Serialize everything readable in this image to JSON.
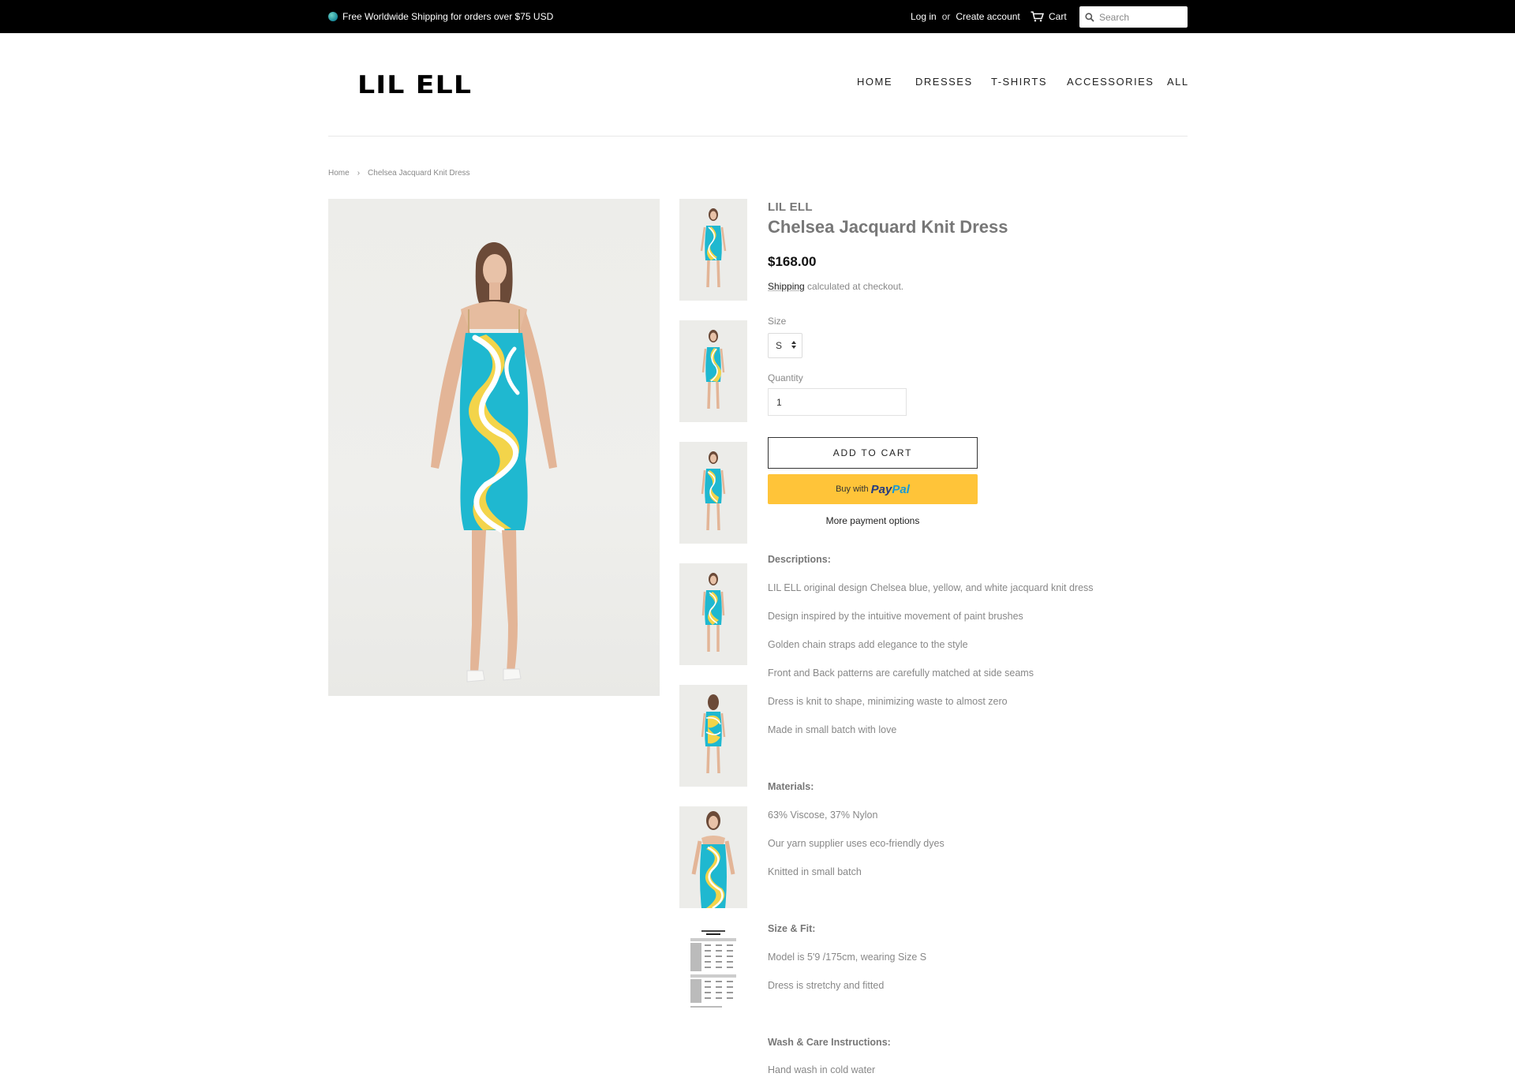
{
  "announcement": {
    "text": "Free Worldwide Shipping for orders over $75 USD",
    "icon": "globe-icon"
  },
  "account": {
    "login": "Log in",
    "or": "or",
    "create": "Create account"
  },
  "cart": {
    "label": "Cart",
    "icon": "cart-icon"
  },
  "search": {
    "placeholder": "Search",
    "icon": "search-icon"
  },
  "brand": {
    "logo": "LIL ELL"
  },
  "nav": {
    "items": [
      "HOME",
      "DRESSES",
      "T-SHIRTS",
      "ACCESSORIES",
      "ALL"
    ]
  },
  "breadcrumb": {
    "home": "Home",
    "separator": "›",
    "current": "Chelsea Jacquard Knit Dress"
  },
  "product": {
    "vendor": "LIL ELL",
    "title": "Chelsea Jacquard Knit Dress",
    "price": "$168.00",
    "shipping_link": "Shipping",
    "shipping_rest": " calculated at checkout.",
    "size_label": "Size",
    "size_value": "S",
    "quantity_label": "Quantity",
    "quantity_value": "1",
    "add_to_cart": "ADD TO CART",
    "paypal_prefix": "Buy with",
    "paypal_brand_1": "Pay",
    "paypal_brand_2": "Pal",
    "more_payment": "More payment options"
  },
  "description": {
    "descriptions_head": "Descriptions:",
    "descriptions": [
      "LIL ELL original design Chelsea blue, yellow, and white jacquard knit dress",
      "Design inspired by the intuitive movement of paint brushes",
      "Golden chain straps add elegance to the style",
      "Front and Back patterns are carefully matched at side seams",
      "Dress is knit to shape, minimizing waste to almost zero",
      "Made in small batch with love"
    ],
    "materials_head": "Materials:",
    "materials": [
      "63% Viscose, 37% Nylon",
      "Our yarn supplier uses eco-friendly dyes",
      "Knitted in small batch"
    ],
    "fit_head": "Size & Fit:",
    "fit": [
      "Model is 5'9 /175cm, wearing Size S",
      "Dress is stretchy and fitted"
    ],
    "care_head": "Wash & Care Instructions:",
    "care": [
      "Hand wash in cold water"
    ]
  },
  "colors": {
    "topbar": "#000000",
    "paypal": "#ffc439",
    "dress_blue": "#1fb8d0",
    "dress_yellow": "#f3d44a"
  }
}
